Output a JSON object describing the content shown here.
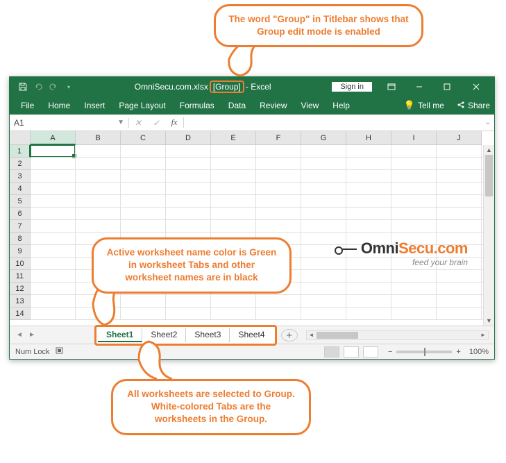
{
  "callouts": {
    "top": "The word \"Group\" in Titlebar shows that Group edit mode is enabled",
    "middle": "Active worksheet name color is Green in worksheet Tabs and other worksheet names are in black",
    "bottom": "All worksheets are selected to Group. White-colored Tabs are the worksheets in the Group."
  },
  "titlebar": {
    "filename": "OmniSecu.com.xlsx",
    "group_indicator": "[Group]",
    "app_suffix": " -  Excel",
    "signin": "Sign in"
  },
  "ribbon": {
    "tabs": [
      "File",
      "Home",
      "Insert",
      "Page Layout",
      "Formulas",
      "Data",
      "Review",
      "View",
      "Help"
    ],
    "tellme": "Tell me",
    "share": "Share"
  },
  "namebox": {
    "value": "A1"
  },
  "columns": [
    "A",
    "B",
    "C",
    "D",
    "E",
    "F",
    "G",
    "H",
    "I",
    "J"
  ],
  "rows": [
    "1",
    "2",
    "3",
    "4",
    "5",
    "6",
    "7",
    "8",
    "9",
    "10",
    "11",
    "12",
    "13",
    "14"
  ],
  "sheets": {
    "tabs": [
      "Sheet1",
      "Sheet2",
      "Sheet3",
      "Sheet4"
    ],
    "active_index": 0
  },
  "statusbar": {
    "numlock": "Num Lock",
    "zoom": "100%"
  },
  "logo": {
    "text_dark": "Omni",
    "text_orange": "Secu.com",
    "tagline": "feed your brain"
  }
}
